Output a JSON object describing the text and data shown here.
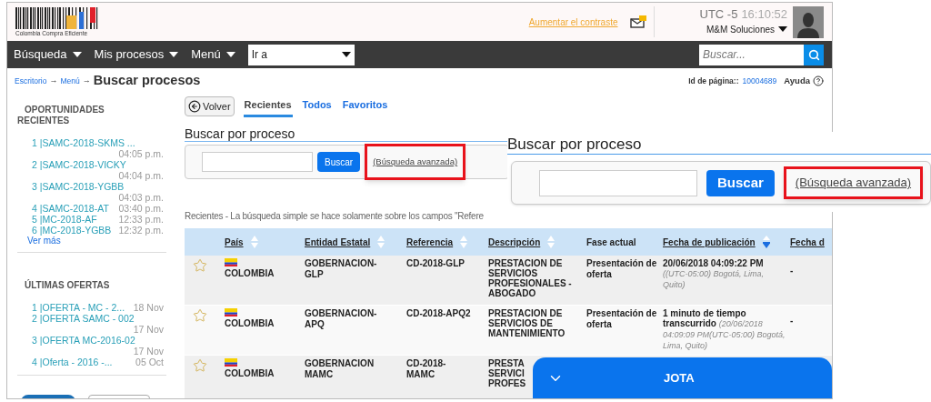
{
  "header": {
    "logo_text": "Colombia Compra Eficiente",
    "contrast_link": "Aumentar el contraste",
    "timezone": "UTC -5",
    "time": "16:10:52",
    "user": "M&M Soluciones",
    "unread_messages": true
  },
  "nav": {
    "menus": [
      "Búsqueda",
      "Mis procesos",
      "Menú"
    ],
    "goto": {
      "value": "Ir a"
    },
    "search": {
      "placeholder": "Buscar..."
    }
  },
  "breadcrumb": {
    "links": [
      "Escritorio",
      "Menú"
    ],
    "separator": "→",
    "current": "Buscar procesos"
  },
  "page_info": {
    "label": "Id de página::",
    "id": "10004689",
    "help": "Ayuda"
  },
  "sidebar": {
    "sections": [
      {
        "title": "OPORTUNIDADES RECIENTES",
        "more": "Ver más",
        "items": [
          {
            "label": "1 |SAMC-2018-SKMS ...",
            "time": "04:05 p.m."
          },
          {
            "label": "2 |SAMC-2018-VICKY",
            "time": "04:04 p.m."
          },
          {
            "label": "3 |SAMC-2018-YGBB",
            "time": "04:03 p.m."
          },
          {
            "label": "4 |SAMC-2018-AT",
            "time": "03:40 p.m."
          },
          {
            "label": "5 |MC-2018-AF",
            "time": "12:33 p.m."
          },
          {
            "label": "6 |MC-2018-YGBB",
            "time": "12:32 p.m."
          }
        ]
      },
      {
        "title": "ÚLTIMAS OFERTAS",
        "items": [
          {
            "label": "1 |OFERTA - MC - 2...",
            "time": "18 Nov"
          },
          {
            "label": "2 |OFERTA SAMC - 002",
            "time": "17 Nov"
          },
          {
            "label": "3 |OFERTA MC-2016-02",
            "time": "17 Nov"
          },
          {
            "label": "4 |Oferta - 2016 -...",
            "time": "05 Oct"
          }
        ]
      }
    ]
  },
  "back_button": "Volver",
  "tabs": [
    {
      "label": "Recientes",
      "selected": true
    },
    {
      "label": "Todos",
      "selected": false
    },
    {
      "label": "Favoritos",
      "selected": false
    }
  ],
  "search_panel": {
    "title": "Buscar por proceso",
    "button": "Buscar",
    "advanced_link": "(Búsqueda avanzada)",
    "highlighted": true
  },
  "note": "Recientes - La búsqueda simple se hace solamente sobre los campos \"Refere",
  "table": {
    "columns": [
      {
        "label": "País",
        "link": true,
        "sortable": true,
        "sorted_descending": false
      },
      {
        "label": "Entidad Estatal",
        "link": true,
        "sortable": true,
        "sorted_descending": false
      },
      {
        "label": "Referencia",
        "link": true,
        "sortable": true,
        "sorted_descending": false
      },
      {
        "label": "Descripción",
        "link": true,
        "sortable": true,
        "sorted_descending": false
      },
      {
        "label": "Fase actual",
        "link": false,
        "sortable": false
      },
      {
        "label": "Fecha de publicación",
        "link": true,
        "sortable": true,
        "sorted_descending": true
      },
      {
        "label": "Fecha d",
        "link": true,
        "sortable": false
      }
    ],
    "rows": [
      {
        "favorite": false,
        "country": "COLOMBIA",
        "entity": "GOBERNACION-GLP",
        "reference": "CD-2018-GLP",
        "description": "PRESTACION DE SERVICIOS PROFESIONALES - ABOGADO",
        "phase": "Presentación de oferta",
        "date": "20/06/2018 04:09:22 PM",
        "date_detail": "((UTC-05:00) Bogotá, Lima, Quito)",
        "column_8": "-"
      },
      {
        "favorite": false,
        "country": "COLOMBIA",
        "entity": "GOBERNACION-APQ",
        "reference": "CD-2018-APQ2",
        "description": "PRESTACION DE SERVICIOS DE MANTENIMIENTO",
        "phase": "Presentación de oferta",
        "date": "1 minuto de tiempo transcurrido",
        "date_detail": "(20/06/2018 04:09:09 PM(UTC-05:00) Bogotá, Lima, Quito)",
        "column_8": "-"
      },
      {
        "favorite": false,
        "country": "COLOMBIA",
        "entity": "GOBERNACION MAMC",
        "reference": "CD-2018-MAMC",
        "description": "PRESTA\nSERVICI\nPROFES"
      }
    ]
  },
  "callout": {
    "title": "Buscar por proceso",
    "button": "Buscar",
    "advanced_link": "(Búsqueda avanzada)",
    "highlighted": true
  },
  "chat_bar": {
    "title": "JOTA",
    "expanded": true
  }
}
